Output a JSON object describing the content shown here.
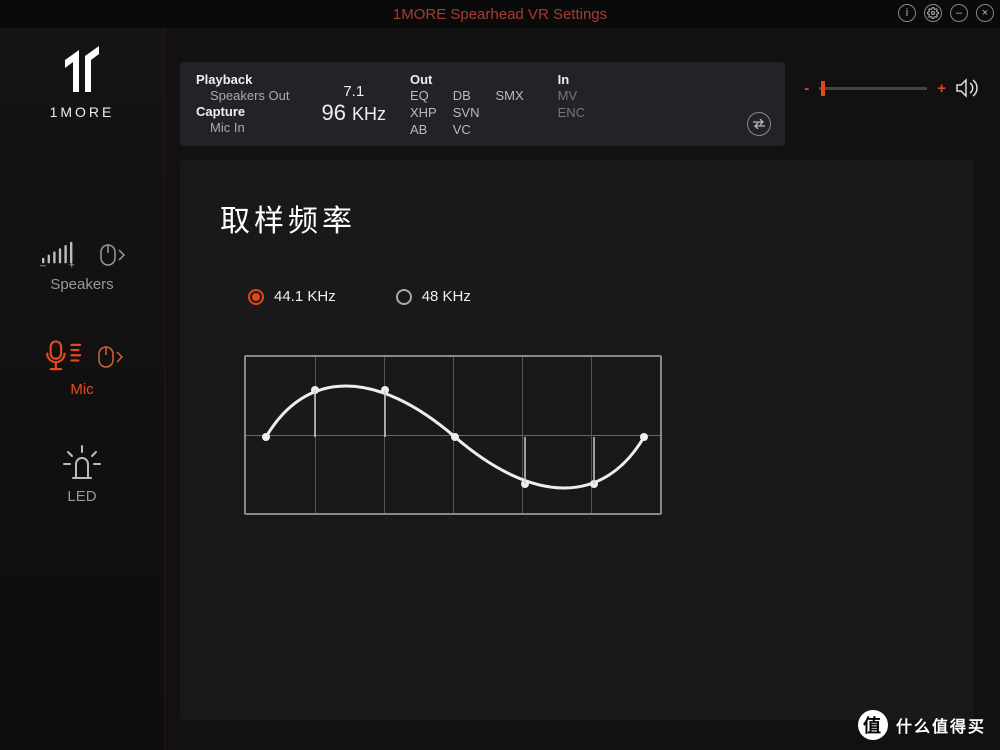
{
  "app": {
    "title": "1MORE Spearhead VR Settings",
    "brand": "1MORE"
  },
  "window_controls": {
    "info": "i",
    "settings": "⚙",
    "minimize": "–",
    "close": "×"
  },
  "sidebar": {
    "items": [
      {
        "id": "speakers",
        "label": "Speakers"
      },
      {
        "id": "mic",
        "label": "Mic"
      },
      {
        "id": "led",
        "label": "LED"
      }
    ]
  },
  "status": {
    "playback_label": "Playback",
    "playback_value": "Speakers Out",
    "capture_label": "Capture",
    "capture_value": "Mic In",
    "channels": "7.1",
    "rate_value": "96",
    "rate_unit": "KHz",
    "out_label": "Out",
    "out_items": [
      "EQ",
      "DB",
      "SMX",
      "XHP",
      "SVN",
      "AB",
      "VC"
    ],
    "in_label": "In",
    "in_items": [
      "MV",
      "ENC"
    ]
  },
  "volume": {
    "minus": "-",
    "plus": "+"
  },
  "main": {
    "heading": "取样频率",
    "options": [
      {
        "value": "44.1 KHz",
        "selected": true
      },
      {
        "value": "48 KHz",
        "selected": false
      }
    ]
  },
  "watermark": {
    "badge": "值",
    "text": "什么值得买"
  },
  "colors": {
    "accent": "#e64514"
  }
}
